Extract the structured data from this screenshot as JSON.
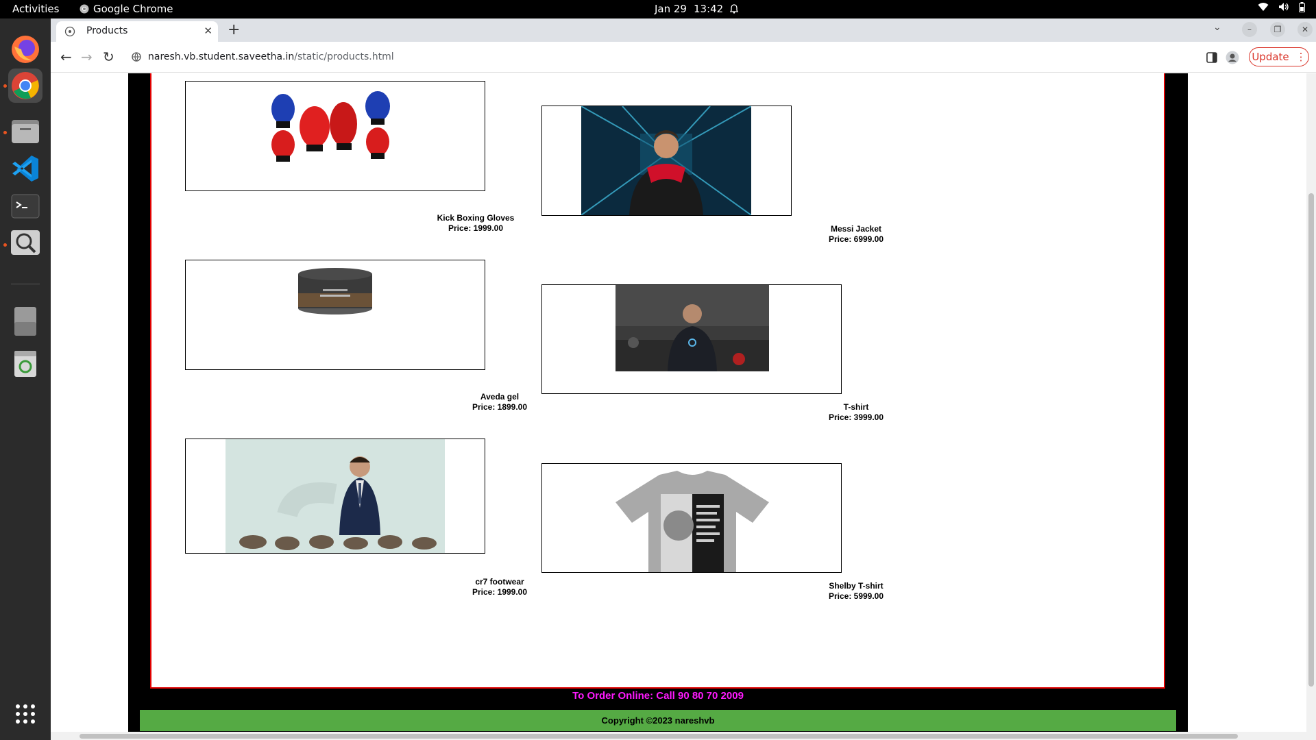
{
  "system": {
    "activities": "Activities",
    "app_name": "Google Chrome",
    "date": "Jan 29",
    "time": "13:42"
  },
  "browser": {
    "tab_title": "Products",
    "url_host": "naresh.vb.student.saveetha.in",
    "url_path": "/static/products.html",
    "update_label": "Update"
  },
  "products": [
    {
      "name": "Kick Boxing Gloves",
      "price": "Price: 1999.00"
    },
    {
      "name": "Messi Jacket",
      "price": "Price: 6999.00"
    },
    {
      "name": "Aveda gel",
      "price": "Price: 1899.00"
    },
    {
      "name": "T-shirt",
      "price": "Price: 3999.00"
    },
    {
      "name": "cr7 footwear",
      "price": "Price: 1999.00"
    },
    {
      "name": "Shelby T-shirt",
      "price": "Price: 5999.00"
    }
  ],
  "footer": {
    "order_text": "To Order Online: Call 90 80 70 2009",
    "copyright": "Copyright ©2023 nareshvb"
  },
  "colors": {
    "order_text": "#ff1aff",
    "copyright_bg": "#55aa44",
    "content_border": "#e00000",
    "update_button": "#d93025"
  }
}
